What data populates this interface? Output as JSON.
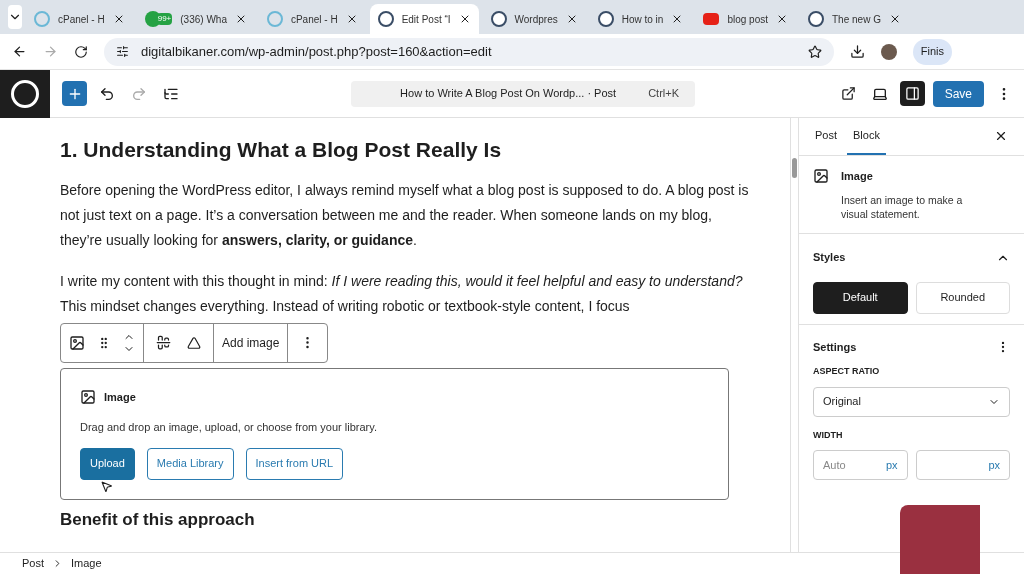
{
  "browser": {
    "tabs": [
      {
        "kind": "cpanel",
        "title": "cPanel - H",
        "selected": false
      },
      {
        "kind": "whatsapp",
        "title": "(336) Wha",
        "badge": "99+",
        "selected": false
      },
      {
        "kind": "cpanel",
        "title": "cPanel - H",
        "selected": false
      },
      {
        "kind": "wordpress",
        "title": "Edit Post “I",
        "selected": true
      },
      {
        "kind": "wordpress",
        "title": "Wordpres",
        "selected": false
      },
      {
        "kind": "wordpress",
        "title": "How to in",
        "selected": false
      },
      {
        "kind": "youtube",
        "title": "blog post",
        "selected": false
      },
      {
        "kind": "wordpress",
        "title": "The new G",
        "selected": false
      }
    ],
    "url": "digitalbikaner.com/wp-admin/post.php?post=160&action=edit",
    "profile_button": "Finis"
  },
  "editor_toolbar": {
    "document_title": "How to Write A Blog Post On Wordp... · Post",
    "shortcut": "Ctrl+K",
    "save": "Save"
  },
  "content": {
    "heading": "1. Understanding What a Blog Post Really Is",
    "paragraphs": [
      "Before opening the WordPress editor, I always remind myself what a blog post is supposed to do. A blog post is not just text on a page. It’s a conversation between me and the reader. When someone lands on my blog, they’re usually looking for **answers, clarity, or guidance**.",
      "I write my content with this thought in mind: *If I were reading this, would it feel helpful and easy to understand?* This mindset changes everything. Instead of writing robotic or textbook-style content, I focus"
    ],
    "block_toolbar": {
      "add_image": "Add image"
    },
    "image_block": {
      "title": "Image",
      "instructions": "Drag and drop an image, upload, or choose from your library.",
      "buttons": [
        {
          "label": "Upload",
          "primary": true
        },
        {
          "label": "Media Library",
          "primary": false
        },
        {
          "label": "Insert from URL",
          "primary": false
        }
      ]
    },
    "next_heading": "Benefit of this approach"
  },
  "sidebar": {
    "tabs": [
      {
        "label": "Post",
        "selected": false
      },
      {
        "label": "Block",
        "selected": true
      }
    ],
    "block_card": {
      "title": "Image",
      "description": "Insert an image to make a visual statement."
    },
    "styles": {
      "title": "Styles",
      "expanded": true,
      "options": [
        {
          "label": "Default",
          "selected": true
        },
        {
          "label": "Rounded",
          "selected": false
        }
      ]
    },
    "settings": {
      "title": "Settings",
      "aspect_ratio_label": "ASPECT RATIO",
      "aspect_ratio": "Original",
      "width_label": "WIDTH",
      "width_placeholder": "Auto",
      "unit": "px",
      "height_unit": "px"
    }
  },
  "breadcrumb": [
    "Post",
    "Image"
  ]
}
